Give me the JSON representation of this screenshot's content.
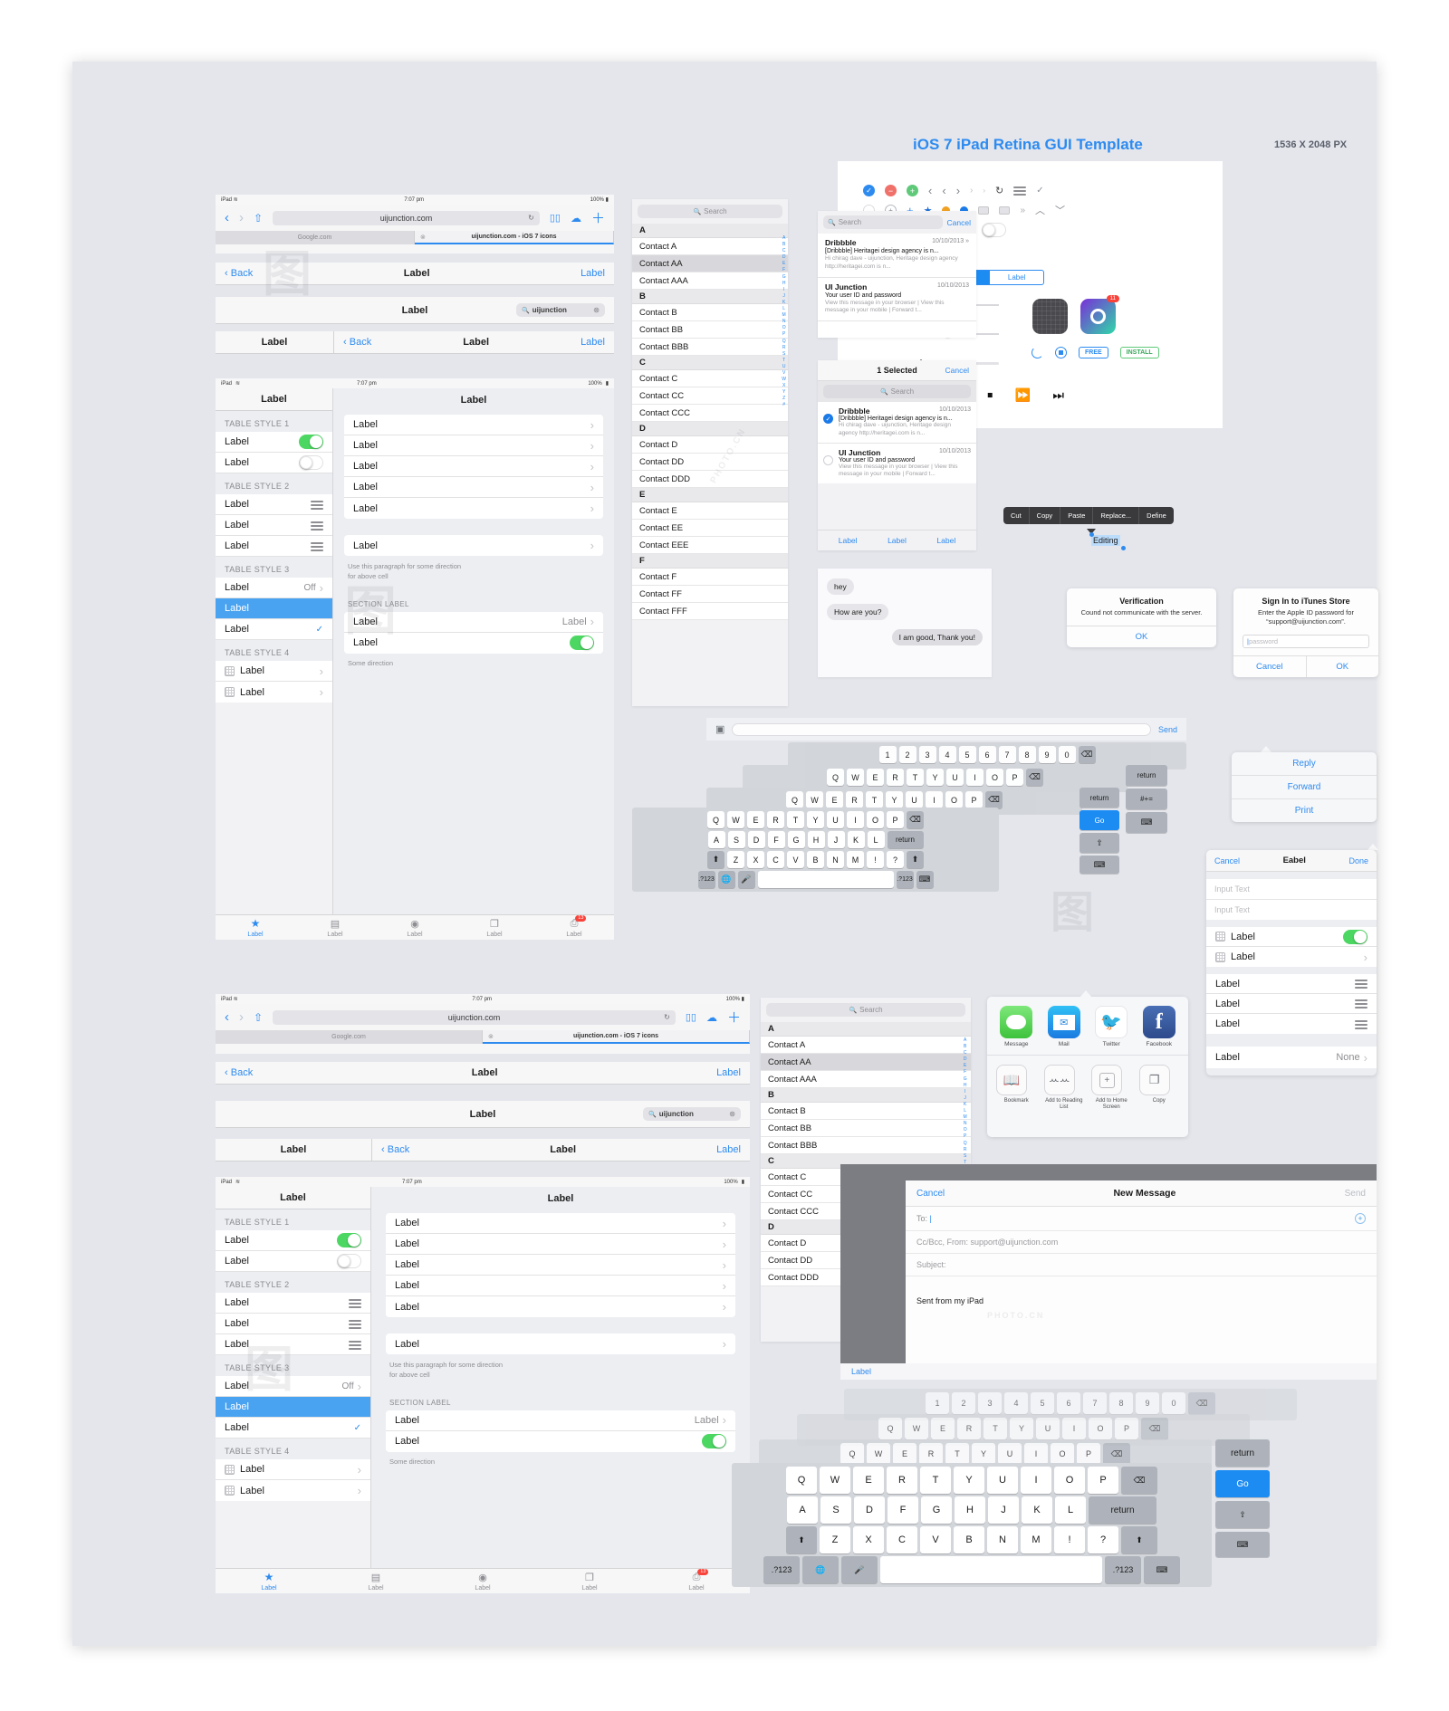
{
  "meta": {
    "title": "iOS 7 iPad Retina GUI Template",
    "dimensions": "1536 X 2048 PX",
    "accent": "#2d8bf0",
    "green": "#4cd763",
    "red": "#f9423a",
    "bg": "#e4e6ec"
  },
  "status_bar": {
    "device": "iPad",
    "time": "7:07 pm",
    "battery": "100%"
  },
  "browser": {
    "url": "uijunction.com",
    "tabs": [
      {
        "label": "Google.com",
        "active": false
      },
      {
        "label": "uijunction.com - iOS 7 icons",
        "active": true
      }
    ],
    "icons": [
      "back-chevron",
      "forward-chevron",
      "share",
      "reload",
      "bookmarks",
      "cloud",
      "plus"
    ]
  },
  "navbars": [
    {
      "left": "Back",
      "title": "Label",
      "right": "Label"
    },
    {
      "left": "",
      "title": "Label",
      "right": "",
      "search_value": "uijunction"
    },
    {
      "left": "Label",
      "title": "Label",
      "right": "Label",
      "second_left": "Back"
    }
  ],
  "settings": {
    "title": "Label",
    "sections": [
      {
        "header": "TABLE STYLE 1",
        "rows": [
          {
            "label": "Label",
            "accessory": "toggle-on"
          },
          {
            "label": "Label",
            "accessory": "toggle-off"
          }
        ]
      },
      {
        "header": "TABLE STYLE 2",
        "rows": [
          {
            "label": "Label",
            "accessory": "grip"
          },
          {
            "label": "Label",
            "accessory": "grip"
          },
          {
            "label": "Label",
            "accessory": "grip"
          }
        ]
      },
      {
        "header": "TABLE STYLE 3",
        "rows": [
          {
            "label": "Label",
            "accessory": "detail-chevron",
            "detail": "Off"
          },
          {
            "label": "Label",
            "accessory": "selected"
          },
          {
            "label": "Label",
            "accessory": "check"
          }
        ]
      },
      {
        "header": "TABLE STYLE 4",
        "rows": [
          {
            "label": "Label",
            "accessory": "icon-chevron"
          },
          {
            "label": "Label",
            "accessory": "icon-chevron"
          }
        ]
      }
    ]
  },
  "detail_pane": {
    "group1": [
      "Label",
      "Label",
      "Label",
      "Label",
      "Label"
    ],
    "group2_label": "Label",
    "footer_note": "Use this paragraph for some direction\nfor above cell",
    "section_label": "SECTION LABEL",
    "group3": [
      {
        "label": "Label",
        "detail": "Label",
        "accessory": "detail-chevron"
      },
      {
        "label": "Label",
        "accessory": "toggle-on"
      }
    ],
    "group3_note": "Some direction"
  },
  "tabbar": {
    "items": [
      {
        "label": "Label",
        "icon": "star-icon",
        "active": true
      },
      {
        "label": "Label",
        "icon": "list-icon",
        "active": false
      },
      {
        "label": "Label",
        "icon": "compass-icon",
        "active": false
      },
      {
        "label": "Label",
        "icon": "window-icon",
        "active": false
      },
      {
        "label": "Label",
        "icon": "download-icon",
        "active": false,
        "badge": "13"
      }
    ]
  },
  "contacts": {
    "search_placeholder": "Search",
    "index": [
      "A",
      "B",
      "C",
      "D",
      "E",
      "F",
      "G",
      "H",
      "I",
      "J",
      "K",
      "L",
      "M",
      "N",
      "O",
      "P",
      "Q",
      "R",
      "S",
      "T",
      "U",
      "V",
      "W",
      "X",
      "Y",
      "Z",
      "#"
    ],
    "groups": [
      {
        "letter": "A",
        "items": [
          "Contact A",
          "Contact AA",
          "Contact AAA"
        ],
        "selected": "Contact AA"
      },
      {
        "letter": "B",
        "items": [
          "Contact B",
          "Contact BB",
          "Contact BBB"
        ]
      },
      {
        "letter": "C",
        "items": [
          "Contact C",
          "Contact CC",
          "Contact CCC"
        ]
      },
      {
        "letter": "D",
        "items": [
          "Contact D",
          "Contact DD",
          "Contact DDD"
        ]
      },
      {
        "letter": "E",
        "items": [
          "Contact E",
          "Contact EE",
          "Contact EEE"
        ]
      },
      {
        "letter": "F",
        "items": [
          "Contact F",
          "Contact FF",
          "Contact FFF"
        ]
      }
    ]
  },
  "mail": {
    "search_placeholder": "Search",
    "cancel": "Cancel",
    "selected_title": "1 Selected",
    "messages": [
      {
        "sender": "Dribbble",
        "date": "10/10/2013",
        "subject": "[Dribbble] Heritagei design agency is n...",
        "preview": "Hi chirag dave - uijunction, Heritage design agency http://heritagei.com is n...",
        "checked": true
      },
      {
        "sender": "UI Junction",
        "date": "10/10/2013",
        "subject": "Your user ID and password",
        "preview": "View this message in your browser | View this message in your mobile | Forward t...",
        "checked": false
      }
    ],
    "toolbar": [
      "Label",
      "Label",
      "Label"
    ]
  },
  "messages": {
    "bubbles": [
      {
        "text": "hey",
        "side": "left"
      },
      {
        "text": "How are you?",
        "side": "left"
      },
      {
        "text": "I am good, Thank you!",
        "side": "right"
      }
    ],
    "send_label": "Send",
    "camera_icon": "camera-icon"
  },
  "template_preview": {
    "segmented": [
      "Label",
      "Label",
      "Label"
    ],
    "segmented_active_index": 1,
    "badge": "11",
    "price_button": "FREE",
    "install_button": "INSTALL",
    "media_controls": [
      "skip-back-icon",
      "rewind-icon",
      "play-icon",
      "pause-icon",
      "stop-icon",
      "fast-forward-icon",
      "skip-forward-icon"
    ],
    "edit_menu": [
      "Cut",
      "Copy",
      "Paste",
      "Replace...",
      "Define"
    ],
    "editing_text": "Editing"
  },
  "alerts": {
    "verification": {
      "title": "Verification",
      "message": "Cound not communicate with the server.",
      "ok": "OK"
    },
    "itunes": {
      "title": "Sign In to iTunes Store",
      "message": "Enter the Apple ID password for “support@uijunction.com”.",
      "password_placeholder": "password",
      "cancel": "Cancel",
      "ok": "OK"
    }
  },
  "action_popover": {
    "items": [
      "Reply",
      "Forward",
      "Print"
    ]
  },
  "modal_form": {
    "cancel": "Cancel",
    "title": "Eabel",
    "done": "Done",
    "inputs": [
      {
        "placeholder": "Input Text"
      },
      {
        "placeholder": "Input Text"
      }
    ],
    "rows": [
      {
        "label": "Label",
        "accessory": "toggle-on",
        "icon": "grid-icon"
      },
      {
        "label": "Label",
        "accessory": "chevron",
        "icon": "grid-icon"
      }
    ]
  },
  "right_table": {
    "rows": [
      {
        "label": "Label",
        "accessory": "grip"
      },
      {
        "label": "Label",
        "accessory": "grip"
      },
      {
        "label": "Label",
        "accessory": "grip"
      }
    ],
    "last_row": {
      "label": "Label",
      "detail": "None",
      "accessory": "detail-chevron"
    }
  },
  "share_sheet": {
    "apps": [
      {
        "label": "Message",
        "icon": "message-icon"
      },
      {
        "label": "Mail",
        "icon": "mail-icon"
      },
      {
        "label": "Twitter",
        "icon": "twitter-icon"
      },
      {
        "label": "Facebook",
        "icon": "facebook-icon"
      }
    ],
    "actions": [
      {
        "label": "Bookmark",
        "icon": "book-icon"
      },
      {
        "label": "Add to Reading List",
        "icon": "glasses-icon"
      },
      {
        "label": "Add to Home Screen",
        "icon": "plus-square-icon"
      },
      {
        "label": "Copy",
        "icon": "copy-icon"
      }
    ]
  },
  "new_message": {
    "cancel": "Cancel",
    "title": "New Message",
    "send": "Send",
    "to_label": "To:",
    "cc_line": "Cc/Bcc, From: support@uijunction.com",
    "subject_label": "Subject:",
    "signature": "Sent from my iPad",
    "add_contact_icon": "plus-circle-icon",
    "label": "Label"
  },
  "keyboard": {
    "number_row": [
      "1",
      "2",
      "3",
      "4",
      "5",
      "6",
      "7",
      "8",
      "9",
      "0"
    ],
    "row1": [
      "Q",
      "W",
      "E",
      "R",
      "T",
      "Y",
      "U",
      "I",
      "O",
      "P"
    ],
    "row2": [
      "A",
      "S",
      "D",
      "F",
      "G",
      "H",
      "J",
      "K",
      "L"
    ],
    "row3": [
      "Z",
      "X",
      "C",
      "V",
      "B",
      "N",
      "M",
      "!",
      "?"
    ],
    "return_label": "return",
    "go_label": "Go",
    "num_label": ".?123",
    "globe_icon": "globe-icon",
    "mic_icon": "mic-icon",
    "hide_icon": "hide-keyboard-icon",
    "shift_icon": "shift-icon",
    "delete_icon": "delete-icon"
  },
  "watermark": "PHOTO.CN"
}
